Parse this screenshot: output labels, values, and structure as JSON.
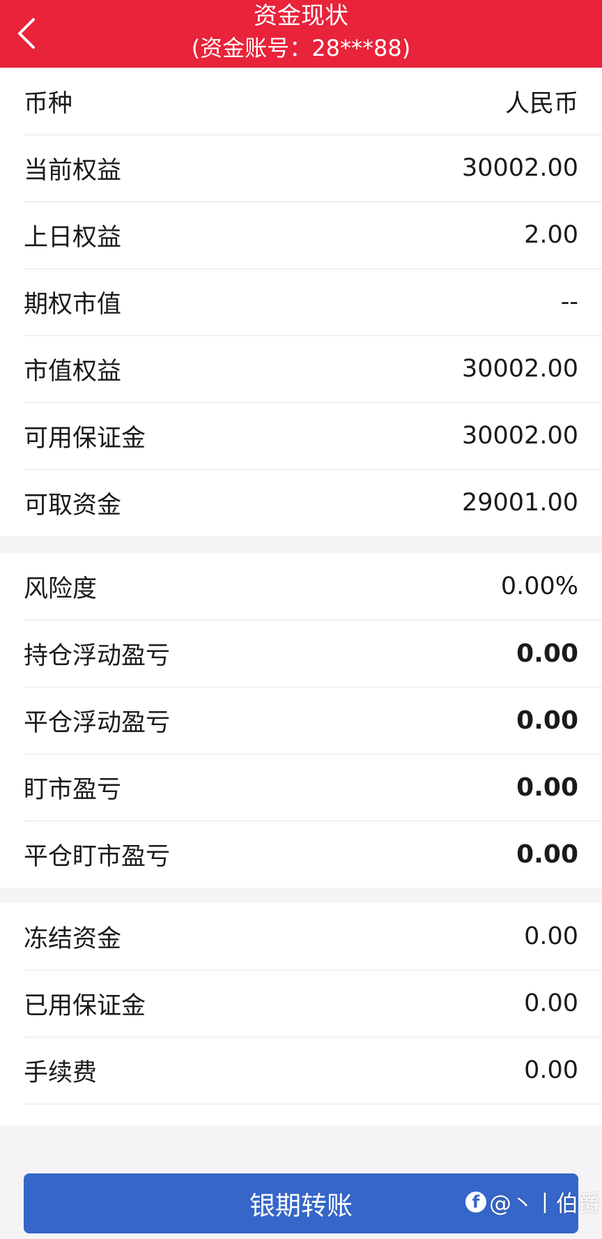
{
  "header": {
    "title": "资金现状",
    "subtitle": "(资金账号：28***88)"
  },
  "groups": [
    {
      "rows": [
        {
          "label": "币种",
          "value": "人民币"
        },
        {
          "label": "当前权益",
          "value": "30002.00"
        },
        {
          "label": "上日权益",
          "value": "2.00"
        },
        {
          "label": "期权市值",
          "value": "--"
        },
        {
          "label": "市值权益",
          "value": "30002.00"
        },
        {
          "label": "可用保证金",
          "value": "30002.00"
        },
        {
          "label": "可取资金",
          "value": "29001.00"
        }
      ]
    },
    {
      "rows": [
        {
          "label": "风险度",
          "value": "0.00%"
        },
        {
          "label": "持仓浮动盈亏",
          "value": "0.00"
        },
        {
          "label": "平仓浮动盈亏",
          "value": "0.00"
        },
        {
          "label": "盯市盈亏",
          "value": "0.00"
        },
        {
          "label": "平仓盯市盈亏",
          "value": "0.00"
        }
      ]
    },
    {
      "rows": [
        {
          "label": "冻结资金",
          "value": "0.00"
        },
        {
          "label": "已用保证金",
          "value": "0.00"
        },
        {
          "label": "手续费",
          "value": "0.00"
        }
      ]
    }
  ],
  "footer": {
    "button_label": "银期转账"
  },
  "watermark": {
    "text": "@丶丨伯爵"
  },
  "colors": {
    "header_bg": "#e8233a",
    "button_bg": "#3566c8"
  }
}
